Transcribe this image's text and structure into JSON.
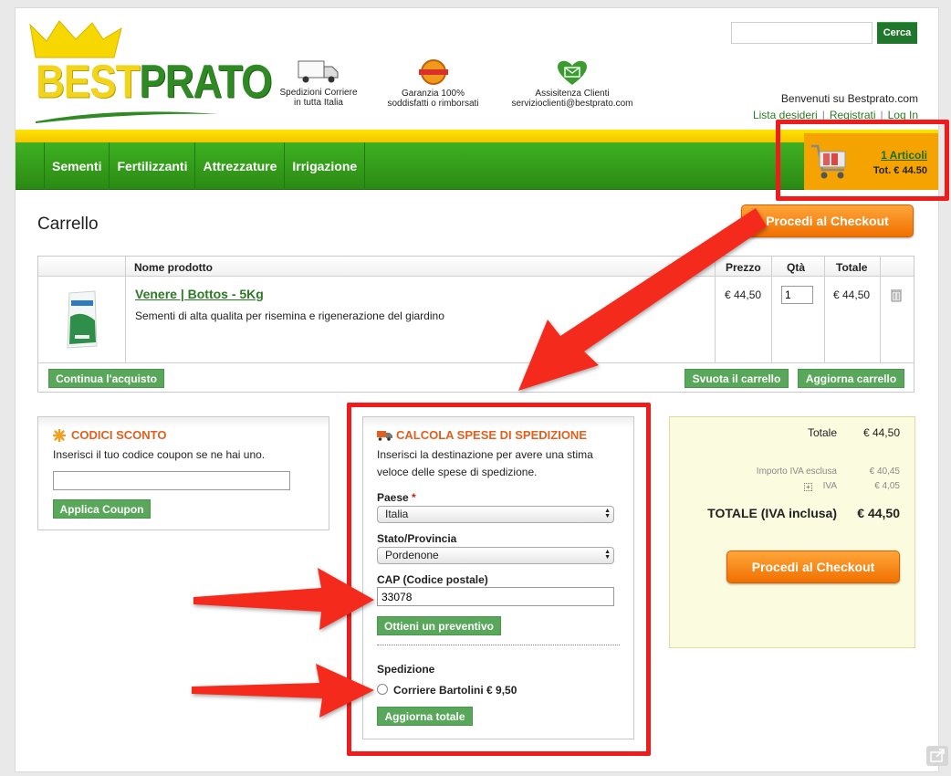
{
  "header": {
    "logo_best": "BEST",
    "logo_prato": "PRATO",
    "search": {
      "placeholder": "",
      "button": "Cerca"
    },
    "features": [
      {
        "icon": "truck-icon",
        "line1": "Spedizioni Corriere",
        "line2": "in tutta Italia"
      },
      {
        "icon": "guarantee-badge-icon",
        "line1": "Garanzia 100%",
        "line2": "soddisfatti o rimborsati"
      },
      {
        "icon": "mail-heart-icon",
        "line1": "Assisitenza Clienti",
        "line2": "servizioclienti@bestprato.com"
      }
    ],
    "welcome": "Benvenuti su Bestprato.com",
    "links": {
      "wishlist": "Lista desideri",
      "register": "Registrati",
      "login": "Log In",
      "sep": "|"
    }
  },
  "nav": {
    "items": [
      "Sementi",
      "Fertilizzanti",
      "Attrezzature",
      "Irrigazione"
    ]
  },
  "minicart": {
    "count": "1 Articoli",
    "total": "Tot. € 44.50"
  },
  "cart": {
    "title": "Carrello",
    "checkout_btn": "Procedi al Checkout",
    "headers": {
      "name": "Nome prodotto",
      "price": "Prezzo",
      "qty": "Qtà",
      "total": "Totale"
    },
    "item": {
      "name": "Venere | Bottos - 5Kg",
      "desc": "Sementi di alta qualita per risemina e rigenerazione del giardino",
      "price": "€ 44,50",
      "qty": "1",
      "total": "€ 44,50"
    },
    "continue_btn": "Continua l'acquisto",
    "empty_btn": "Svuota il carrello",
    "update_btn": "Aggiorna carrello"
  },
  "coupon": {
    "title": "CODICI SCONTO",
    "text": "Inserisci il tuo codice coupon se ne hai uno.",
    "value": "",
    "button": "Applica Coupon"
  },
  "shipping": {
    "title": "CALCOLA SPESE DI SPEDIZIONE",
    "text1": "Inserisci la destinazione per avere una stima",
    "text2": "veloce delle spese di spedizione.",
    "country_label": "Paese",
    "required_mark": "*",
    "country_value": "Italia",
    "region_label": "Stato/Provincia",
    "region_value": "Pordenone",
    "zip_label": "CAP (Codice postale)",
    "zip_value": "33078",
    "quote_btn": "Ottieni un preventivo",
    "method_label": "Spedizione",
    "method_option": "Corriere Bartolini € 9,50",
    "update_btn": "Aggiorna totale"
  },
  "totals": {
    "subtotal_label": "Totale",
    "subtotal_value": "€ 44,50",
    "excl_label": "Importo IVA esclusa",
    "excl_value": "€ 40,45",
    "iva_label": "IVA",
    "iva_value": "€ 4,05",
    "grand_label": "TOTALE (IVA inclusa)",
    "grand_value": "€ 44,50",
    "checkout_btn": "Procedi al Checkout"
  },
  "colors": {
    "nav_green": "#2a8a14",
    "accent_orange": "#f07000",
    "annotation_red": "#f01c1c",
    "button_green": "#58a75a"
  }
}
